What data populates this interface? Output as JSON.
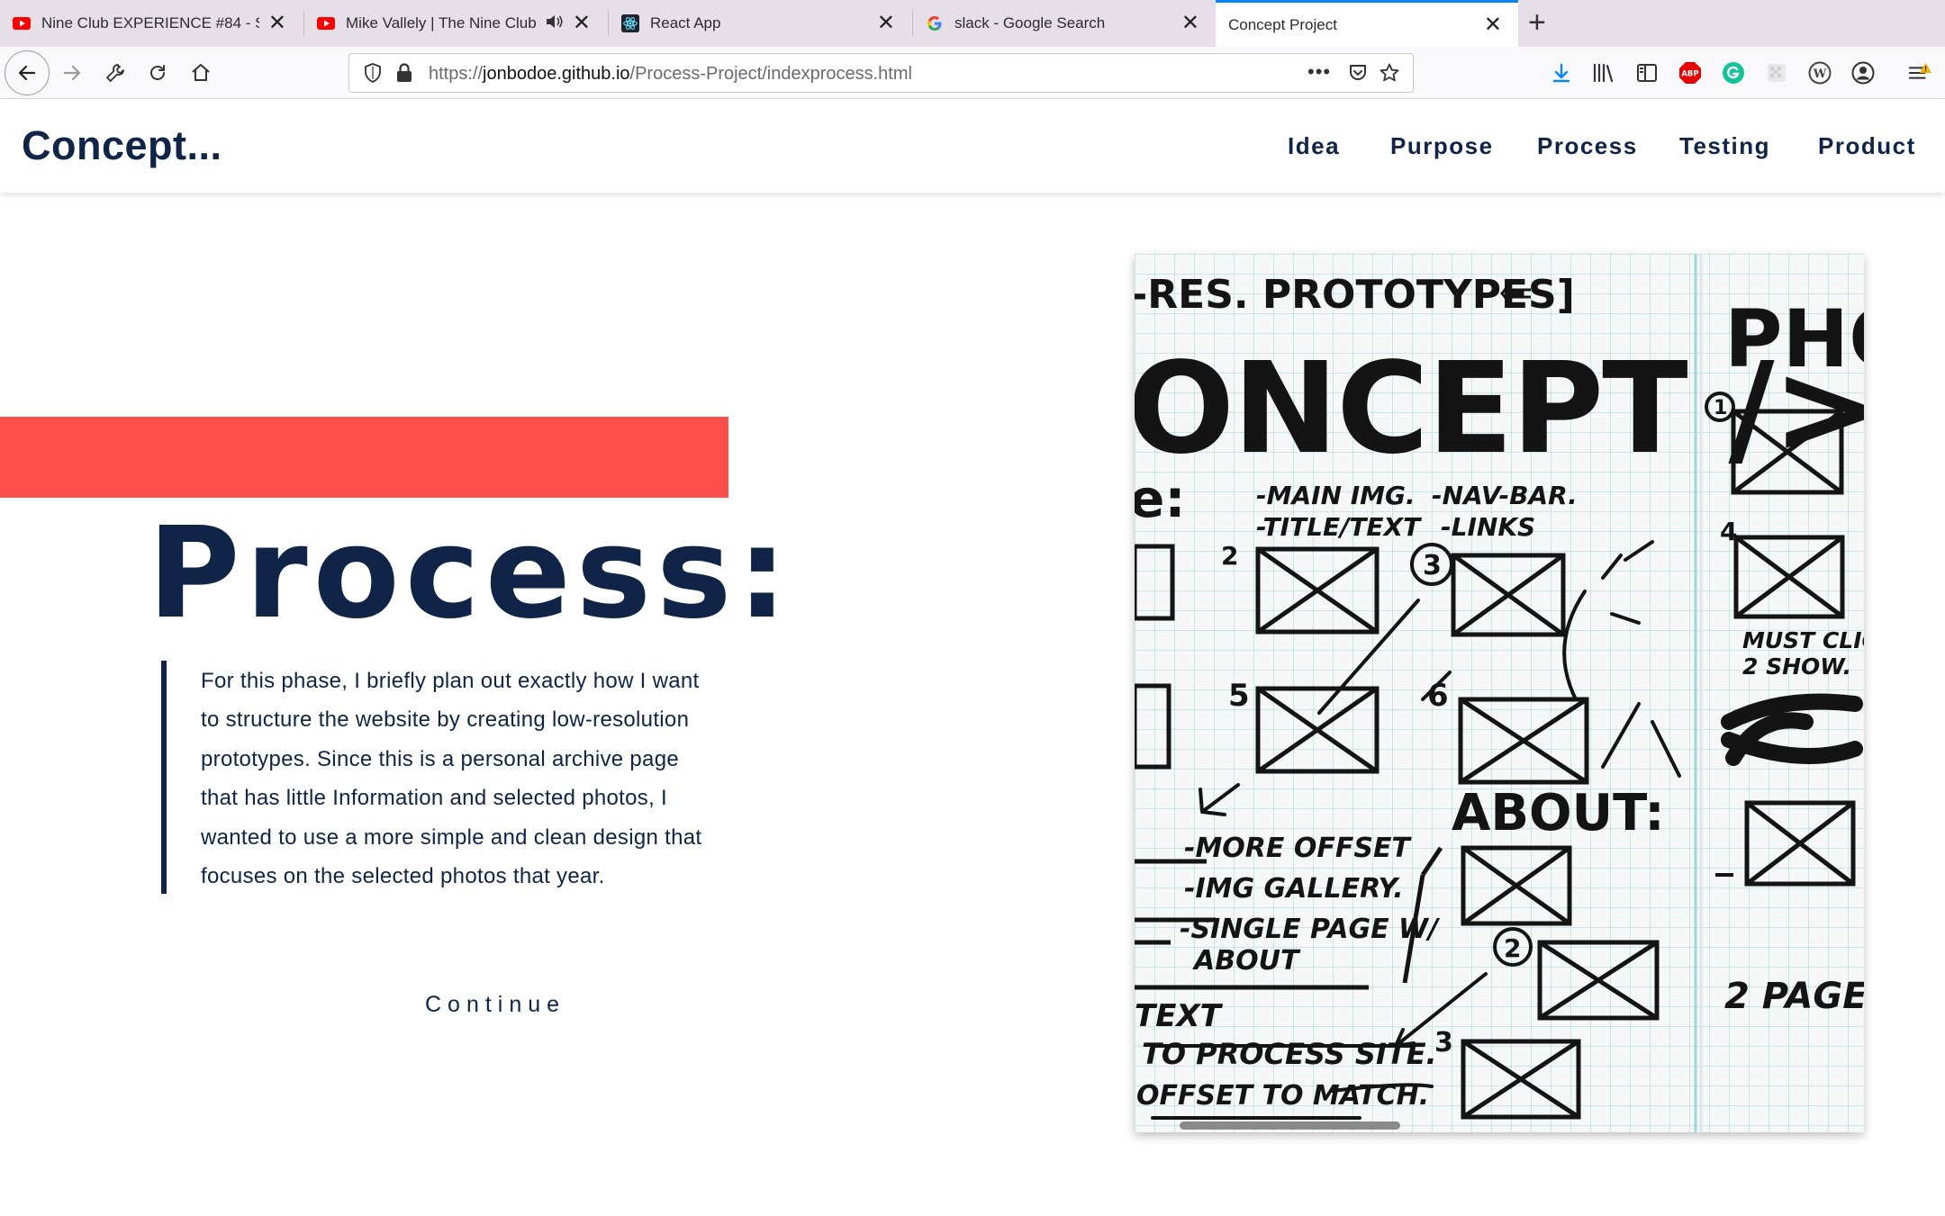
{
  "browser": {
    "tabs": [
      {
        "title": "Nine Club EXPERIENCE #84 - S",
        "favicon": "youtube-icon",
        "active": false
      },
      {
        "title": "Mike Vallely | The Nine Club",
        "favicon": "youtube-icon",
        "active": false,
        "audio": true
      },
      {
        "title": "React App",
        "favicon": "react-icon",
        "active": false
      },
      {
        "title": "slack - Google Search",
        "favicon": "google-icon",
        "active": false
      },
      {
        "title": "Concept Project",
        "favicon": "",
        "active": true
      }
    ],
    "url_prefix": "https://",
    "url_host": "jonbodoe.github.io",
    "url_path": "/Process-Project/indexprocess.html",
    "page_actions_label": "•••",
    "accent_color": "#0a84ff"
  },
  "site": {
    "logo": "Concept...",
    "nav": [
      "Idea",
      "Purpose",
      "Process",
      "Testing",
      "Product"
    ],
    "heading": "Process:",
    "body": "For this phase, I briefly plan out exactly how I want to structure the website by creating low-resolution prototypes. Since this is a personal archive page that has little Information and selected photos, I wanted to use a more simple and clean design that focuses on the selected photos that year.",
    "body_lines": [
      "For this phase, I briefly plan out exactly how I want",
      "to structure the website by creating low-resolution",
      "prototypes. Since this is a personal archive page",
      "that has little Information and selected photos, I",
      "wanted to use a more simple and clean design that",
      "focuses on the selected photos that year."
    ],
    "continue_label": "Continue",
    "colors": {
      "navy": "#0f2447",
      "accent_red": "#ff4f4b"
    }
  },
  "sketch": {
    "title": "-RES. PROTOTYPES]",
    "headline": "ONCEPT />",
    "page_title_partial": "PHO",
    "notes_top": [
      "-MAIN IMG.",
      "-TITLE/TEXT",
      "-NAV-BAR.",
      "-LINKS"
    ],
    "notes_top_prefix": "e:",
    "notes_mid": [
      "-MORE OFFSET",
      "-IMG GALLERY.",
      "-SINGLE PAGE W/",
      "ABOUT"
    ],
    "about_label": "ABOUT:",
    "notes_bottom": [
      "TEXT",
      "TO PROCESS SITE.",
      "OFFSET TO MATCH."
    ],
    "right_notes": [
      "MUST CLIC",
      "2 SHOW."
    ],
    "pages_label": "2 PAGES",
    "numbers": [
      "2",
      "3",
      "4",
      "5",
      "6",
      "1",
      "2",
      "3"
    ]
  }
}
